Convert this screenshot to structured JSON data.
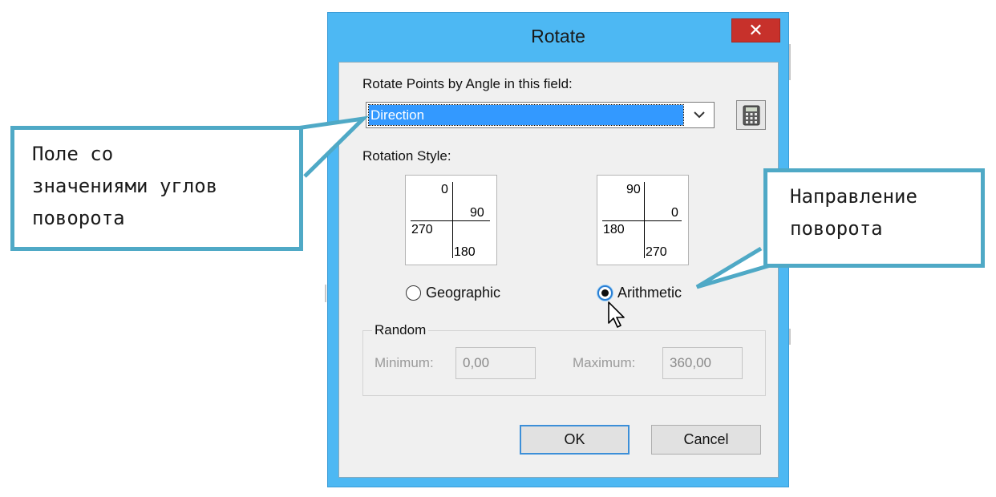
{
  "dialog": {
    "title": "Rotate",
    "close_label": "✕",
    "field_label": "Rotate Points by Angle in this field:",
    "field_value": "Direction",
    "rotation_style_label": "Rotation Style:",
    "geographic": {
      "top": "0",
      "right": "90",
      "left": "270",
      "bottom": "180",
      "label": "Geographic",
      "selected": false
    },
    "arithmetic": {
      "top": "90",
      "right": "0",
      "left": "180",
      "bottom": "270",
      "label": "Arithmetic",
      "selected": true
    },
    "random": {
      "title": "Random",
      "minimum_label": "Minimum:",
      "minimum_value": "0,00",
      "maximum_label": "Maximum:",
      "maximum_value": "360,00"
    },
    "ok_label": "OK",
    "cancel_label": "Cancel"
  },
  "callouts": {
    "left_line1": "Поле со",
    "left_line2": "значениями углов",
    "left_line3": "поворота",
    "right_line1": "Направление",
    "right_line2": "поворота"
  },
  "icons": {
    "calculator": "calculator-icon",
    "dropdown": "chevron-down-icon",
    "cursor": "mouse-pointer-icon",
    "close": "close-icon"
  },
  "colors": {
    "window_frame": "#4db8f3",
    "close_button": "#c7312b",
    "selection": "#3399ff",
    "callout_border": "#4fa9c6"
  }
}
